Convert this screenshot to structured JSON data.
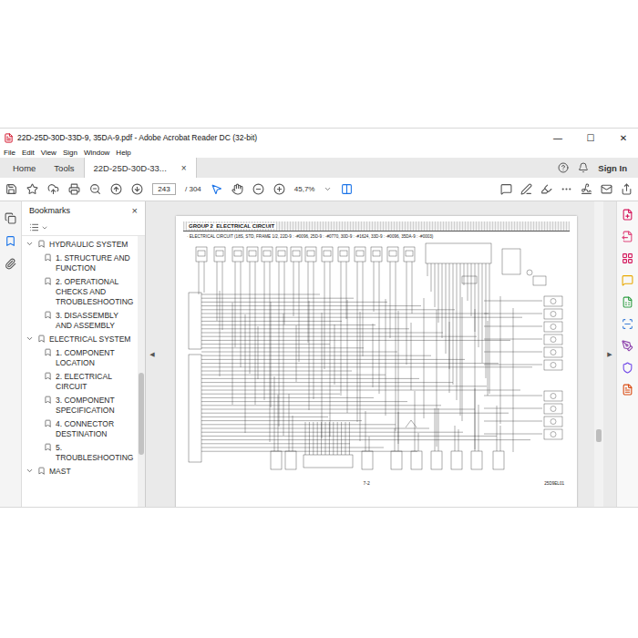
{
  "window": {
    "title": "22D-25D-30D-33D-9, 35DA-9.pdf - Adobe Acrobat Reader DC (32-bit)",
    "controls": [
      "—",
      "☐",
      "✕"
    ]
  },
  "menu": [
    "File",
    "Edit",
    "View",
    "Sign",
    "Window",
    "Help"
  ],
  "tabs": [
    {
      "label": "Home",
      "selected": false,
      "closable": false
    },
    {
      "label": "Tools",
      "selected": false,
      "closable": false
    },
    {
      "label": "22D-25D-30D-33...",
      "selected": true,
      "closable": true
    }
  ],
  "tab_close": "×",
  "account": {
    "sign_in": "Sign In"
  },
  "toolbar": {
    "page": "243",
    "page_count": "/ 304",
    "zoom": "45,7%"
  },
  "bookmarks": {
    "title": "Bookmarks",
    "close": "×",
    "groups": [
      {
        "label": "HYDRAULIC SYSTEM",
        "expanded": true,
        "items": [
          "1. STRUCTURE AND FUNCTION",
          "2. OPERATIONAL CHECKS AND TROUBLESHOOTING",
          "3. DISASSEMBLY AND ASSEMBLY"
        ]
      },
      {
        "label": "ELECTRICAL SYSTEM",
        "expanded": true,
        "items": [
          "1. COMPONENT LOCATION",
          "2. ELECTRICAL CIRCUIT",
          "3. COMPONENT SPECIFICATION",
          "4. CONNECTOR DESTINATION",
          "5. TROUBLESHOOTING"
        ]
      },
      {
        "label": "MAST",
        "expanded": true,
        "items": []
      }
    ]
  },
  "page": {
    "header": "GROUP 2  ELECTRICAL CIRCUIT",
    "subtitle": "· ELECTRICAL CIRCUIT (18S, STD, FRAME 1/2, 22D-9 : -#0096, 25D-9 : -#0770, 30D-9 : -#1624, 33D-9 : -#0096, 35DA-9 : -#0003)",
    "number": "7-2",
    "code": "25D9EL01"
  },
  "nav": {
    "prev": "◀",
    "next": "▶"
  }
}
